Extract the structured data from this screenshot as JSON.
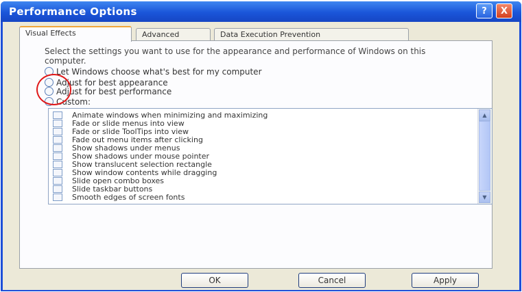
{
  "window": {
    "title": "Performance Options",
    "help_label": "?",
    "close_label": "X"
  },
  "tabs": [
    {
      "label": "Visual Effects",
      "active": true
    },
    {
      "label": "Advanced",
      "active": false
    },
    {
      "label": "Data Execution Prevention",
      "active": false
    }
  ],
  "description": "Select the settings you want to use for the appearance and performance of Windows on this computer.",
  "options": [
    {
      "label": "Let Windows choose what's best for my computer"
    },
    {
      "label": "Adjust for best appearance"
    },
    {
      "label": "Adjust for best performance"
    },
    {
      "label": "Custom:"
    }
  ],
  "effects": [
    "Animate windows when minimizing and maximizing",
    "Fade or slide menus into view",
    "Fade or slide ToolTips into view",
    "Fade out menu items after clicking",
    "Show shadows under menus",
    "Show shadows under mouse pointer",
    "Show translucent selection rectangle",
    "Show window contents while dragging",
    "Slide open combo boxes",
    "Slide taskbar buttons",
    "Smooth edges of screen fonts"
  ],
  "scroll": {
    "up_symbol": "▲",
    "down_symbol": "▼"
  },
  "buttons": {
    "ok": "OK",
    "cancel": "Cancel",
    "apply": "Apply"
  },
  "colors": {
    "accent_tab": "#f1a63a",
    "title_bar": "#1a55d9",
    "highlight_circle": "#e01818"
  }
}
